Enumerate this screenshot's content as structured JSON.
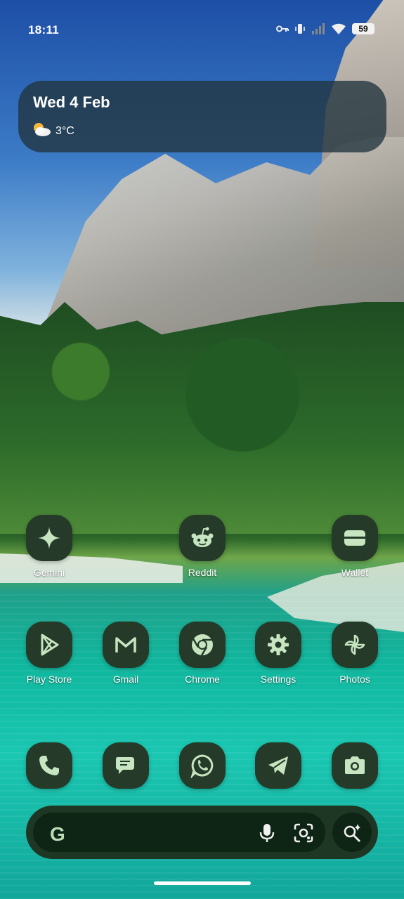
{
  "status_bar": {
    "time": "18:11",
    "battery": "59",
    "icons": [
      "key-icon",
      "vibrate-icon",
      "signal-icon",
      "wifi-icon",
      "battery-icon"
    ]
  },
  "widget": {
    "date": "Wed 4 Feb",
    "temperature": "3°C",
    "weather_icon": "partly-cloudy-icon"
  },
  "apps": [
    {
      "label": "Gemini",
      "icon": "gemini-sparkle-icon"
    },
    {
      "label": "Reddit",
      "icon": "reddit-icon"
    },
    {
      "label": "Wallet",
      "icon": "wallet-icon"
    },
    {
      "label": "Play Store",
      "icon": "play-store-icon"
    },
    {
      "label": "Gmail",
      "icon": "gmail-icon"
    },
    {
      "label": "Chrome",
      "icon": "chrome-icon"
    },
    {
      "label": "Settings",
      "icon": "gear-icon"
    },
    {
      "label": "Photos",
      "icon": "photos-pinwheel-icon"
    }
  ],
  "dock": [
    {
      "icon": "phone-icon"
    },
    {
      "icon": "messages-icon"
    },
    {
      "icon": "whatsapp-icon"
    },
    {
      "icon": "telegram-icon"
    },
    {
      "icon": "camera-icon"
    }
  ],
  "search_bar": {
    "logo": "G",
    "icons": [
      "microphone-icon",
      "google-lens-icon",
      "ai-search-icon"
    ]
  },
  "colors": {
    "icon_bg": "#253a29",
    "icon_fg": "#c6e5c0",
    "search_bg": "#1e3724"
  }
}
